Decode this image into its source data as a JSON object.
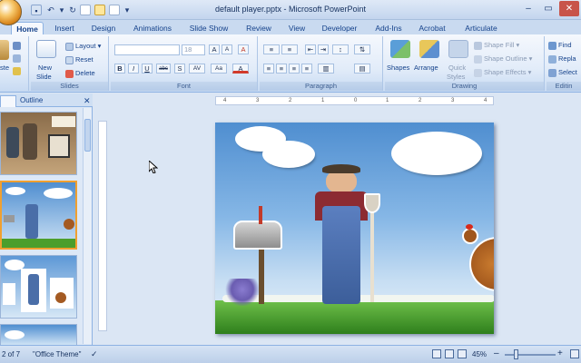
{
  "window": {
    "title": "default player.pptx - Microsoft PowerPoint",
    "minimize": "–",
    "maximize": "▭",
    "close": "✕"
  },
  "tabs": [
    "Home",
    "Insert",
    "Design",
    "Animations",
    "Slide Show",
    "Review",
    "View",
    "Developer",
    "Add-Ins",
    "Acrobat",
    "Articulate"
  ],
  "active_tab": "Home",
  "ribbon": {
    "clipboard": {
      "paste": "Paste"
    },
    "slides": {
      "label": "Slides",
      "new_slide_line1": "New",
      "new_slide_line2": "Slide",
      "layout": "Layout",
      "reset": "Reset",
      "delete": "Delete"
    },
    "font": {
      "label": "Font",
      "font_size": "18",
      "bold": "B",
      "italic": "I",
      "underline": "U",
      "strike": "abc",
      "shadow": "S",
      "spacing": "AV",
      "change_case": "Aa",
      "grow": "A",
      "shrink": "A",
      "clear": "A",
      "color": "A"
    },
    "paragraph": {
      "label": "Paragraph"
    },
    "drawing": {
      "label": "Drawing",
      "shapes": "Shapes",
      "arrange": "Arrange",
      "quick_styles_line1": "Quick",
      "quick_styles_line2": "Styles",
      "shape_fill": "Shape Fill",
      "shape_outline": "Shape Outline",
      "shape_effects": "Shape Effects"
    },
    "editing": {
      "label": "Editin",
      "find": "Find",
      "replace": "Repla",
      "select": "Select"
    }
  },
  "left_pane": {
    "tab_outline": "Outline"
  },
  "ruler": {
    "h_ticks": [
      "4",
      "3",
      "2",
      "1",
      "0",
      "1",
      "2",
      "3",
      "4"
    ]
  },
  "statusbar": {
    "slide_info": "2 of 7",
    "theme": "\"Office Theme\"",
    "zoom": "45%",
    "zoom_minus": "–",
    "zoom_plus": "+"
  },
  "colors": {
    "ribbon_bg": "#e2ecf9",
    "accent": "#15428b",
    "selection": "#f0a030",
    "sky": "#4f8ed0"
  }
}
